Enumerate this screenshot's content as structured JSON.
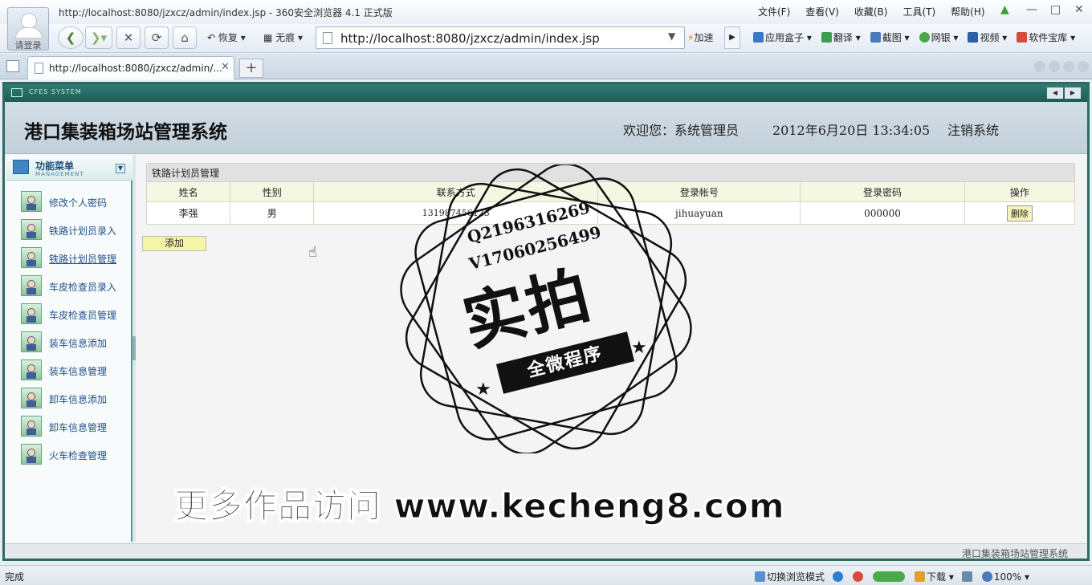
{
  "browser": {
    "window_title": "http://localhost:8080/jzxcz/admin/index.jsp - 360安全浏览器 4.1 正式版",
    "login_label": "请登录",
    "menus": [
      "文件(F)",
      "查看(V)",
      "收藏(B)",
      "工具(T)",
      "帮助(H)"
    ],
    "toolbar": {
      "restore": "恢复",
      "incognito": "无痕",
      "speed": "加速"
    },
    "address": "http://localhost:8080/jzxcz/admin/index.jsp",
    "tools": [
      "应用盒子",
      "翻译",
      "截图",
      "网银",
      "视频",
      "软件宝库"
    ],
    "tab_title": "http://localhost:8080/jzxcz/admin/...",
    "status_done": "完成",
    "status_items": [
      "切换浏览模式",
      "下载",
      "100%"
    ],
    "colors": {
      "accent": "#2b6b63",
      "header_bg": "#c9d6df",
      "menu_link": "#1f4f8a"
    }
  },
  "app": {
    "sysbar_label": "CFES SYSTEM",
    "title": "港口集装箱场站管理系统",
    "welcome": "欢迎您：系统管理员",
    "datetime": "2012年6月20日  13:34:05",
    "logout": "注销系统",
    "menu": {
      "title": "功能菜单",
      "subtitle": "MANAGEMENT",
      "items": [
        "修改个人密码",
        "铁路计划员录入",
        "铁路计划员管理",
        "车皮检查员录入",
        "车皮检查员管理",
        "装车信息添加",
        "装车信息管理",
        "卸车信息添加",
        "卸车信息管理",
        "火车检查管理"
      ]
    },
    "table": {
      "caption": "铁路计划员管理",
      "headers": [
        "姓名",
        "性别",
        "联系方式",
        "登录帐号",
        "登录密码",
        "操作"
      ],
      "rows": [
        {
          "name": "李强",
          "gender": "男",
          "phone": "131987456123",
          "account": "jihuayuan",
          "password": "000000",
          "action": "删除"
        }
      ]
    },
    "add_button": "添加",
    "footer": "港口集装箱场站管理系统"
  },
  "watermark": {
    "qq": "Q2196316269",
    "wechat": "V17060256499",
    "big": "实拍",
    "ribbon": "全微程序",
    "promo": "更多作品访问 www.kecheng8.com"
  }
}
